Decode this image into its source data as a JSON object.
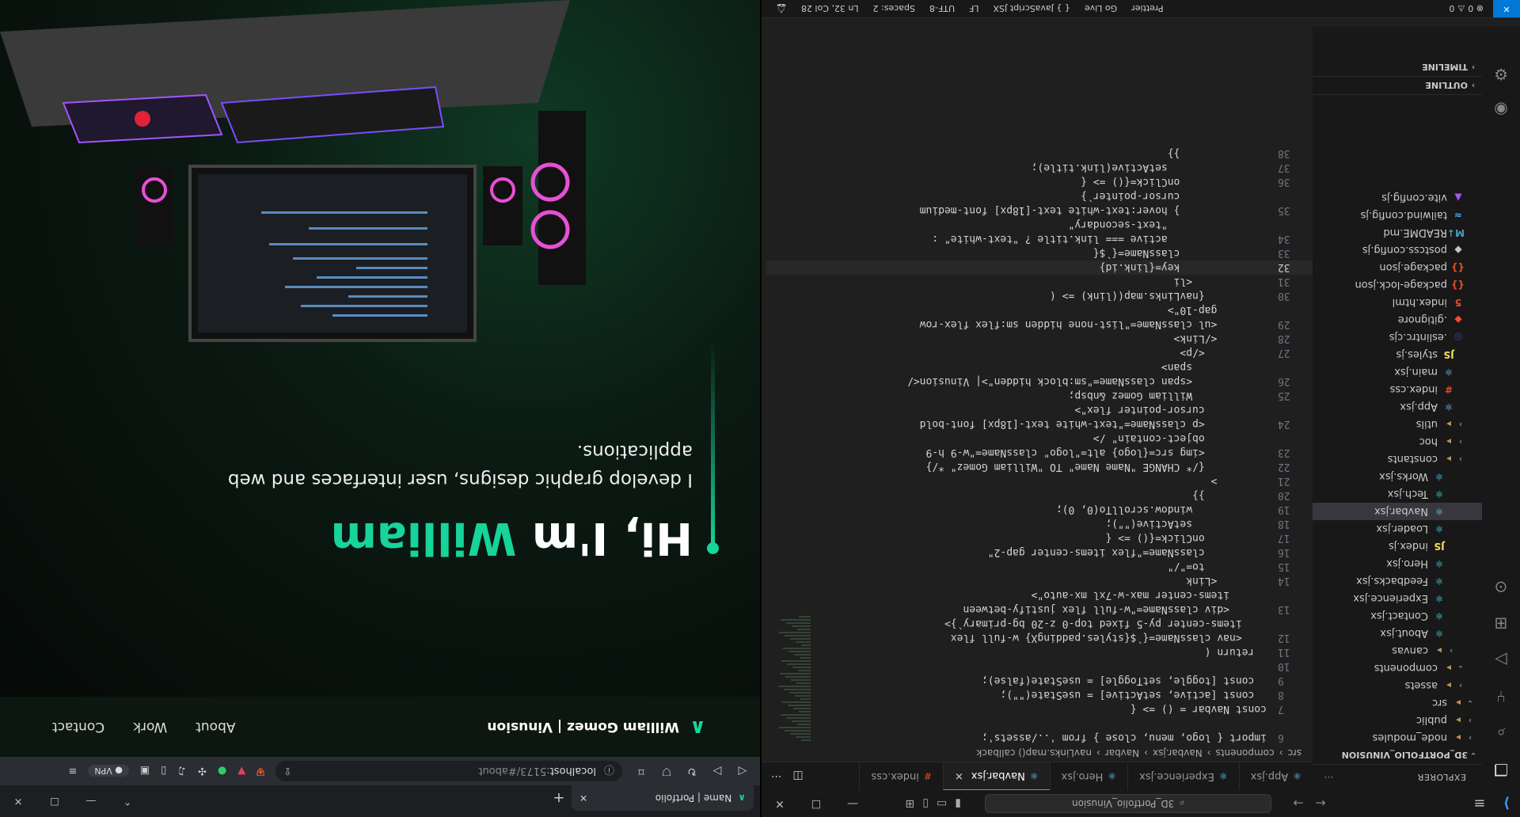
{
  "vscode": {
    "title_search": "3D_Portfolio_Vinusion",
    "sidebar": {
      "header": "EXPLORER",
      "project": "3D_PORTFOLIO_VINUSION",
      "items": [
        {
          "label": "node_modules",
          "type": "folder",
          "depth": 0
        },
        {
          "label": "public",
          "type": "folder",
          "depth": 0
        },
        {
          "label": "src",
          "type": "folder",
          "depth": 0,
          "open": true
        },
        {
          "label": "assets",
          "type": "folder",
          "depth": 1
        },
        {
          "label": "components",
          "type": "folder",
          "depth": 1,
          "open": true
        },
        {
          "label": "canvas",
          "type": "folder",
          "depth": 2
        },
        {
          "label": "About.jsx",
          "type": "react",
          "depth": 2
        },
        {
          "label": "Contact.jsx",
          "type": "react",
          "depth": 2
        },
        {
          "label": "Experience.jsx",
          "type": "react",
          "depth": 2
        },
        {
          "label": "Feedbacks.jsx",
          "type": "react",
          "depth": 2
        },
        {
          "label": "Hero.jsx",
          "type": "react",
          "depth": 2
        },
        {
          "label": "index.js",
          "type": "js",
          "depth": 2
        },
        {
          "label": "Loader.jsx",
          "type": "react",
          "depth": 2
        },
        {
          "label": "Navbar.jsx",
          "type": "react",
          "depth": 2,
          "selected": true
        },
        {
          "label": "Tech.jsx",
          "type": "react",
          "depth": 2
        },
        {
          "label": "Works.jsx",
          "type": "react",
          "depth": 2
        },
        {
          "label": "constants",
          "type": "folder",
          "depth": 1
        },
        {
          "label": "hoc",
          "type": "folder",
          "depth": 1
        },
        {
          "label": "utils",
          "type": "folder",
          "depth": 1
        },
        {
          "label": "App.jsx",
          "type": "react",
          "depth": 1
        },
        {
          "label": "index.css",
          "type": "css",
          "depth": 1
        },
        {
          "label": "main.jsx",
          "type": "react",
          "depth": 1
        },
        {
          "label": "styles.js",
          "type": "js",
          "depth": 1
        },
        {
          "label": ".eslintrc.cjs",
          "type": "eslint",
          "depth": 0
        },
        {
          "label": ".gitignore",
          "type": "git",
          "depth": 0
        },
        {
          "label": "index.html",
          "type": "html",
          "depth": 0
        },
        {
          "label": "package-lock.json",
          "type": "json",
          "depth": 0
        },
        {
          "label": "package.json",
          "type": "json",
          "depth": 0
        },
        {
          "label": "postcss.config.js",
          "type": "config",
          "depth": 0
        },
        {
          "label": "README.md",
          "type": "md",
          "depth": 0
        },
        {
          "label": "tailwind.config.js",
          "type": "tailwind",
          "depth": 0
        },
        {
          "label": "vite.config.js",
          "type": "vite",
          "depth": 0
        }
      ],
      "outline": "OUTLINE",
      "timeline": "TIMELINE"
    },
    "tabs": [
      {
        "label": "App.jsx",
        "icon": "react",
        "active": false
      },
      {
        "label": "Experience.jsx",
        "icon": "react",
        "active": false
      },
      {
        "label": "Hero.jsx",
        "icon": "react",
        "active": false
      },
      {
        "label": "Navbar.jsx",
        "icon": "react",
        "active": true
      },
      {
        "label": "index.css",
        "icon": "css",
        "active": false
      }
    ],
    "breadcrumb": [
      "src",
      "components",
      "Navbar.jsx",
      "Navbar",
      "navLinks.map() callback"
    ],
    "code_lines": [
      {
        "n": "6",
        "t": "import { logo, menu, close } from '../assets';"
      },
      {
        "n": "",
        "t": ""
      },
      {
        "n": "7",
        "t": "const Navbar = () => {"
      },
      {
        "n": "8",
        "t": "  const [active, setActive] = useState(\"\");"
      },
      {
        "n": "9",
        "t": "  const [toggle, setToggle] = useState(false);"
      },
      {
        "n": "10",
        "t": ""
      },
      {
        "n": "11",
        "t": "  return ("
      },
      {
        "n": "12",
        "t": "    <nav className={`${styles.paddingX} w-full flex"
      },
      {
        "n": "",
        "t": "    items-center py-5 fixed top-0 z-20 bg-primary`}>"
      },
      {
        "n": "13",
        "t": "      <div className=\"w-full flex justify-between"
      },
      {
        "n": "",
        "t": "      items-center max-w-7xl mx-auto\">"
      },
      {
        "n": "14",
        "t": "        <Link"
      },
      {
        "n": "15",
        "t": "          to=\"/\""
      },
      {
        "n": "16",
        "t": "          className=\"flex items-center gap-2\""
      },
      {
        "n": "17",
        "t": "          onClick={() => {"
      },
      {
        "n": "18",
        "t": "            setActive(\"\");"
      },
      {
        "n": "19",
        "t": "            window.scrollTo(0, 0);"
      },
      {
        "n": "20",
        "t": "          }}"
      },
      {
        "n": "21",
        "t": "        >"
      },
      {
        "n": "22",
        "t": "          {/* CHANGE \"Name Name\" TO \"William Gomez\" */}"
      },
      {
        "n": "23",
        "t": "          <img src={logo} alt=\"logo\" className=\"w-9 h-9"
      },
      {
        "n": "",
        "t": "          object-contain\" />"
      },
      {
        "n": "24",
        "t": "          <p className=\"text-white text-[18px] font-bold"
      },
      {
        "n": "",
        "t": "          cursor-pointer flex\">"
      },
      {
        "n": "25",
        "t": "            William Gomez &nbsp;"
      },
      {
        "n": "26",
        "t": "            <span className=\"sm:block hidden\">| Vinusion</"
      },
      {
        "n": "",
        "t": "            span>"
      },
      {
        "n": "27",
        "t": "          </p>"
      },
      {
        "n": "28",
        "t": "        </Link>"
      },
      {
        "n": "29",
        "t": "        <ul className=\"list-none hidden sm:flex flex-row"
      },
      {
        "n": "",
        "t": "        gap-10\">"
      },
      {
        "n": "30",
        "t": "          {navLinks.map((link) => ("
      },
      {
        "n": "31",
        "t": "            <li"
      },
      {
        "n": "32",
        "t": "              key={link.id}",
        "current": true
      },
      {
        "n": "33",
        "t": "              className={`${"
      },
      {
        "n": "34",
        "t": "                active === link.title ? \"text-white\" :"
      },
      {
        "n": "",
        "t": "                \"text-secondary\""
      },
      {
        "n": "35",
        "t": "              } hover:text-white text-[18px] font-medium"
      },
      {
        "n": "",
        "t": "              cursor-pointer`}"
      },
      {
        "n": "36",
        "t": "              onClick={() => {"
      },
      {
        "n": "37",
        "t": "                setActive(link.title);"
      },
      {
        "n": "38",
        "t": "              }}"
      }
    ],
    "status": {
      "errors": "0",
      "warnings": "0",
      "items_right": [
        "Ln 32, Col 28",
        "Spaces: 2",
        "UTF-8",
        "LF",
        "{ } JavaScript JSX",
        "Go Live",
        "Prettier"
      ]
    }
  },
  "browser": {
    "tab_title": "Name | Portfolio",
    "url_host": "localhost",
    "url_rest": ":5173/#about",
    "vpn_label": "VPN",
    "site": {
      "brand": "William Gomez | Vinusion",
      "nav_links": [
        "About",
        "Work",
        "Contact"
      ],
      "hero_prefix": "Hi, I'm ",
      "hero_name": "William",
      "hero_subtitle": "I develop graphic designs, user interfaces and web applications."
    }
  },
  "colors": {
    "accent": "#17d49a",
    "vscode_bg": "#1f1f1f",
    "vscode_blue": "#0078d4"
  }
}
